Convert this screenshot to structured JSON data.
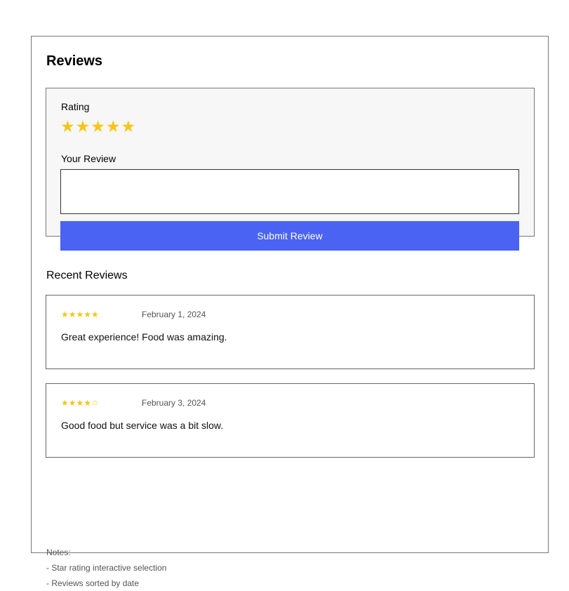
{
  "page": {
    "title": "Reviews"
  },
  "form": {
    "rating_label": "Rating",
    "rating_value": 5,
    "rating_max": 5,
    "star_char": "★",
    "review_label": "Your Review",
    "review_value": "",
    "submit_label": "Submit Review"
  },
  "recent": {
    "title": "Recent Reviews",
    "items": [
      {
        "stars": "★★★★★",
        "rating": 5,
        "date": "February 1, 2024",
        "text": "Great experience! Food was amazing."
      },
      {
        "stars": "★★★★☆",
        "rating": 4,
        "date": "February 3, 2024",
        "text": "Good food but service was a bit slow."
      }
    ]
  },
  "notes": {
    "heading": "Notes:",
    "items": [
      "- Star rating interactive selection",
      "- Reviews sorted by date"
    ]
  },
  "colors": {
    "star": "#f5c518",
    "accent": "#4a63f2",
    "form_background": "#f7f7f7",
    "border": "#777777"
  }
}
